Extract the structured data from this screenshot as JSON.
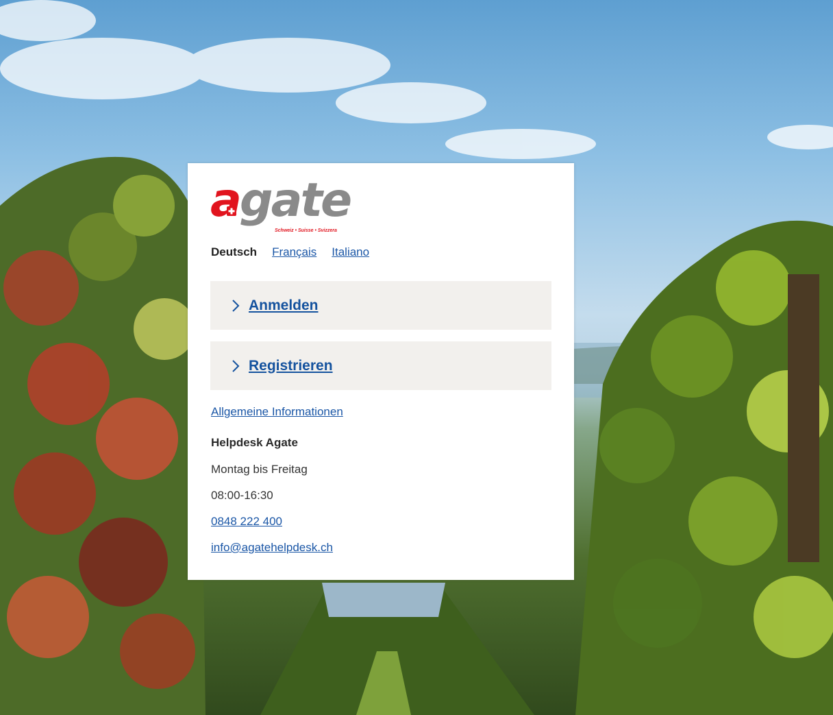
{
  "logo": {
    "brand": "agate",
    "brand_first": "a",
    "brand_rest": "gate",
    "tagline": "Schweiz • Suisse • Svizzera",
    "colors": {
      "red": "#e1141e",
      "grey": "#8a8a8a"
    }
  },
  "languages": {
    "active": "Deutsch",
    "options": [
      "Français",
      "Italiano"
    ]
  },
  "actions": {
    "login": "Anmelden",
    "register": "Registrieren"
  },
  "general_info": "Allgemeine Informationen",
  "helpdesk": {
    "title": "Helpdesk Agate",
    "days": "Montag bis Freitag",
    "hours": "08:00-16:30",
    "phone": "0848 222 400",
    "email": "info@agatehelpdesk.ch"
  },
  "colors": {
    "link": "#1a56a6",
    "action_bg": "#f2f0ed"
  }
}
